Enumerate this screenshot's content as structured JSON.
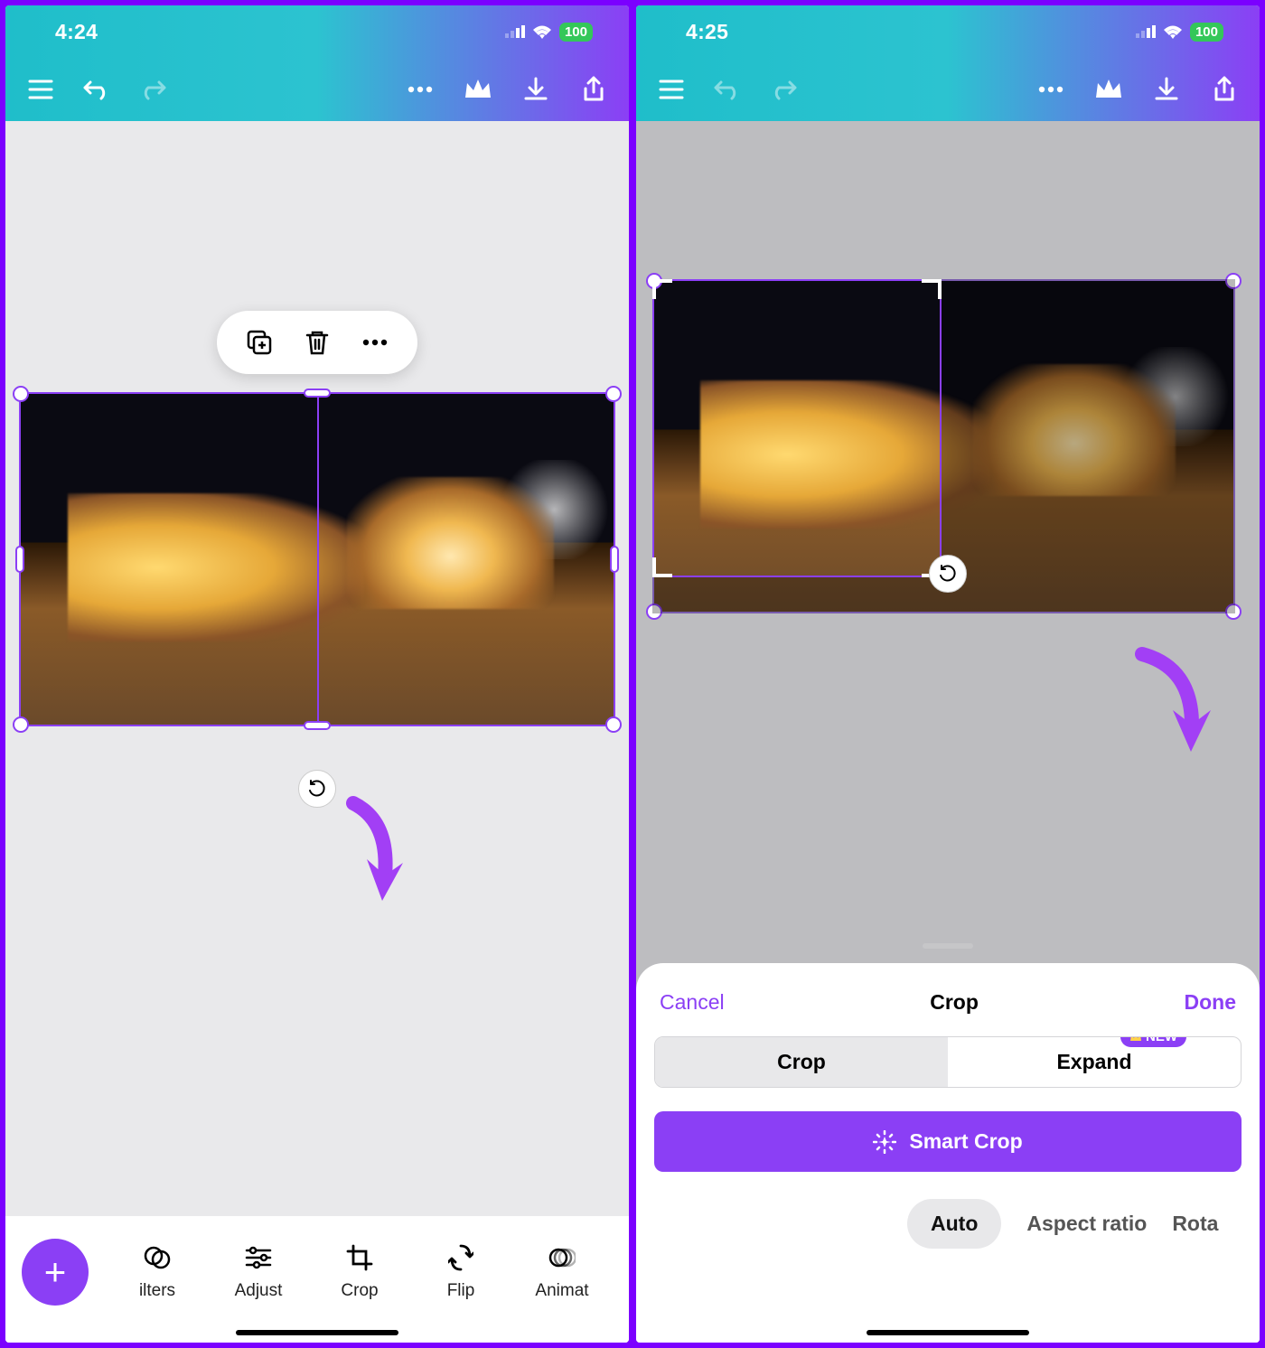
{
  "left": {
    "status": {
      "time": "4:24",
      "battery": "100"
    },
    "context_icons": [
      "duplicate-icon",
      "trash-icon",
      "more-icon"
    ],
    "strip": [
      {
        "label": "ilters",
        "icon": "filters-icon"
      },
      {
        "label": "Adjust",
        "icon": "adjust-icon"
      },
      {
        "label": "Crop",
        "icon": "crop-icon"
      },
      {
        "label": "Flip",
        "icon": "flip-icon"
      },
      {
        "label": "Animat",
        "icon": "animate-icon"
      }
    ]
  },
  "right": {
    "status": {
      "time": "4:25",
      "battery": "100"
    },
    "sheet": {
      "cancel": "Cancel",
      "title": "Crop",
      "done": "Done",
      "seg": {
        "crop": "Crop",
        "expand": "Expand",
        "new_badge": "NEW"
      },
      "smart_crop": "Smart Crop",
      "pills": {
        "auto": "Auto",
        "aspect": "Aspect ratio",
        "rotate": "Rota"
      }
    }
  },
  "toolbar_icons": [
    "menu-icon",
    "undo-icon",
    "redo-icon",
    "more-icon",
    "crown-icon",
    "download-icon",
    "share-icon"
  ]
}
